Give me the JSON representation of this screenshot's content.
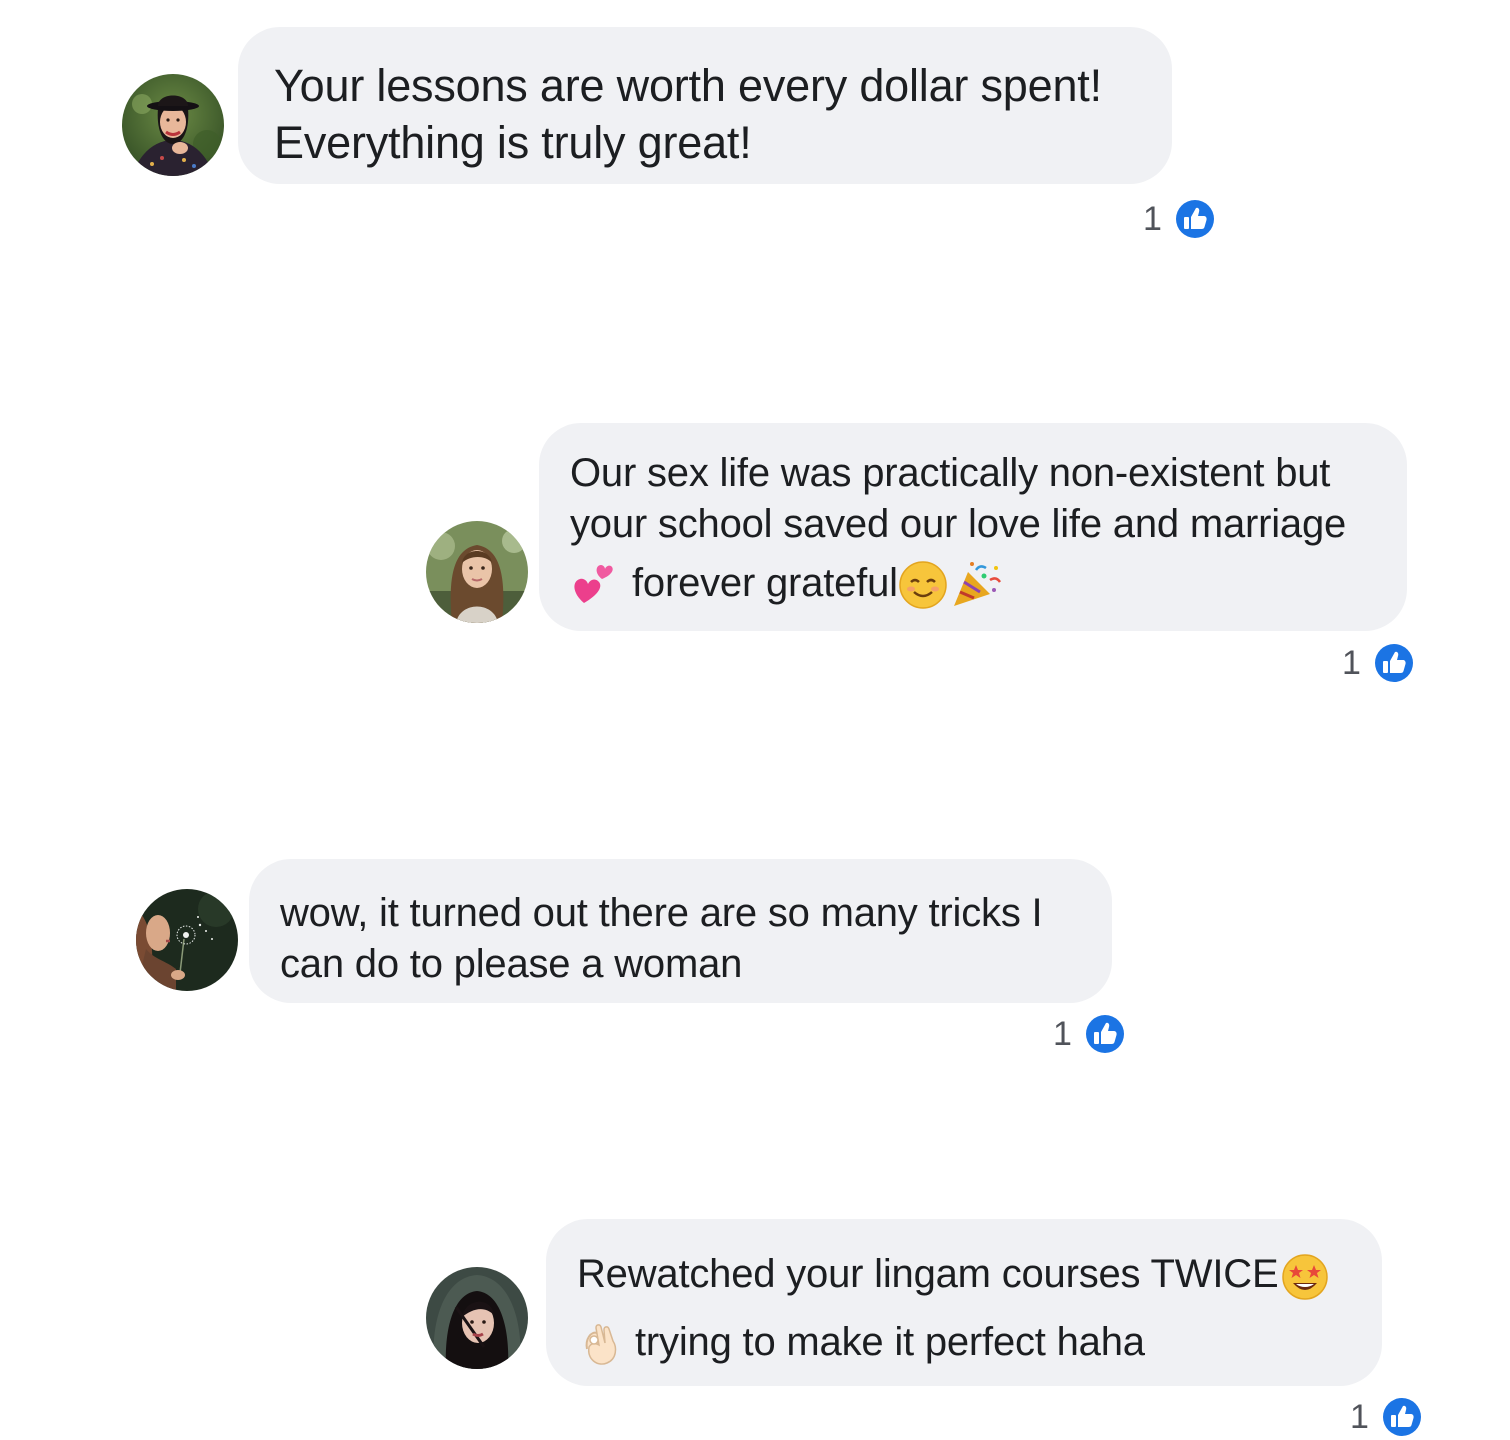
{
  "comments": [
    {
      "lines": [
        "Your lessons are worth every dollar spent!",
        "Everything is truly great!"
      ],
      "reaction_count": "1",
      "avatar": "avatar-woman-black-hat"
    },
    {
      "lines": [
        "Our sex life was practically non-existent but",
        "your school saved our love life and marriage"
      ],
      "line3_text": "forever grateful",
      "line3_leading_icon": "two-hearts-emoji",
      "line3_trailing_icons": [
        "smiling-face-emoji",
        "party-popper-emoji"
      ],
      "reaction_count": "1",
      "avatar": "avatar-woman-long-brown-hair"
    },
    {
      "lines": [
        "wow, it turned out there are so many tricks I",
        "can do to please a woman"
      ],
      "reaction_count": "1",
      "avatar": "avatar-woman-dandelion"
    },
    {
      "line1_text": "Rewatched your lingam courses TWICE",
      "line1_trailing_icon": "star-struck-emoji",
      "line2_text": "trying to make it perfect haha",
      "line2_leading_icon": "ok-hand-emoji",
      "reaction_count": "1",
      "avatar": "avatar-woman-dark-hood"
    }
  ],
  "colors": {
    "bubble": "#f0f1f4",
    "text": "#1c1e21",
    "count": "#50535a",
    "like_blue": "#1b74e4"
  }
}
